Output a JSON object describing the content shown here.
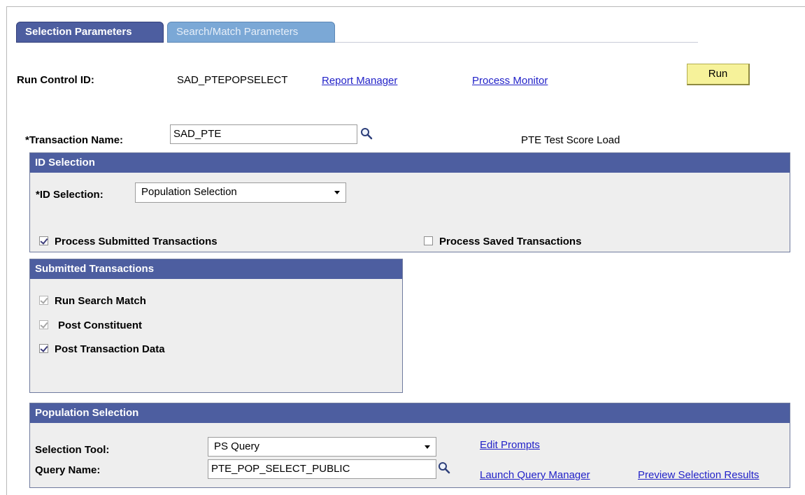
{
  "tabs": [
    {
      "label": "Selection Parameters",
      "active": true
    },
    {
      "label": "Search/Match Parameters",
      "active": false
    }
  ],
  "header": {
    "run_control_label": "Run Control ID:",
    "run_control_value": "SAD_PTEPOPSELECT",
    "report_manager_link": "Report Manager",
    "process_monitor_link": "Process Monitor",
    "run_button": "Run"
  },
  "transaction": {
    "label": "*Transaction Name:",
    "value": "SAD_PTE",
    "description": "PTE Test Score Load"
  },
  "id_selection": {
    "title": "ID Selection",
    "label": "*ID Selection:",
    "selected": "Population Selection",
    "process_submitted": {
      "label": "Process Submitted Transactions",
      "checked": true
    },
    "process_saved": {
      "label": "Process Saved Transactions",
      "checked": false
    }
  },
  "submitted_transactions": {
    "title": "Submitted Transactions",
    "items": [
      {
        "label": "Run Search Match",
        "checked": true,
        "disabled": true
      },
      {
        "label": "Post Constituent",
        "checked": true,
        "disabled": true
      },
      {
        "label": "Post Transaction Data",
        "checked": true,
        "disabled": false
      }
    ]
  },
  "population_selection": {
    "title": "Population Selection",
    "selection_tool_label": "Selection Tool:",
    "selection_tool_value": "PS Query",
    "query_name_label": "Query Name:",
    "query_name_value": "PTE_POP_SELECT_PUBLIC",
    "edit_prompts_link": "Edit Prompts",
    "launch_query_manager_link": "Launch Query Manager",
    "preview_results_link": "Preview Selection Results"
  },
  "colors": {
    "panel_header": "#4d5ea0",
    "tab_inactive": "#7ba8d6",
    "run_button": "#f6f29a",
    "link": "#2222c8"
  },
  "icons": {
    "lookup": "magnifier-icon",
    "dropdown": "chevron-down-icon"
  }
}
